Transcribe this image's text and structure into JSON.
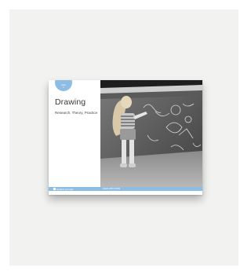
{
  "cover": {
    "badge_line1": "issue",
    "badge_line2": "1",
    "title": "Drawing",
    "subtitle": "Research, Theory, Practice",
    "publisher": "intellect journals",
    "series_text": "ISSN 2057-0384",
    "accent_color": "#8ebde3"
  },
  "photo": {
    "description_icon": "photo-icon"
  }
}
